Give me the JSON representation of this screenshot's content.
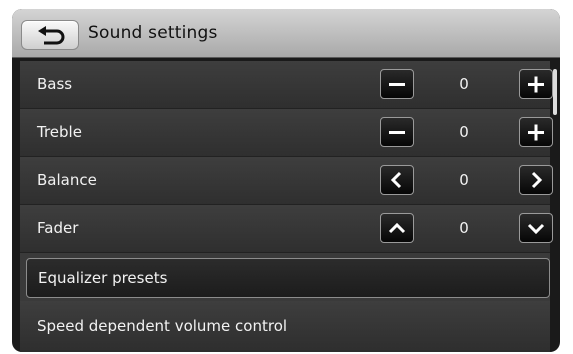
{
  "header": {
    "title": "Sound settings",
    "back_icon": "back-arrow-icon"
  },
  "rows": [
    {
      "label": "Bass",
      "value": "0",
      "left_icon": "minus-icon",
      "right_icon": "plus-icon"
    },
    {
      "label": "Treble",
      "value": "0",
      "left_icon": "minus-icon",
      "right_icon": "plus-icon"
    },
    {
      "label": "Balance",
      "value": "0",
      "left_icon": "chevron-left-icon",
      "right_icon": "chevron-right-icon"
    },
    {
      "label": "Fader",
      "value": "0",
      "left_icon": "chevron-up-icon",
      "right_icon": "chevron-down-icon"
    }
  ],
  "equalizer": {
    "label": "Equalizer presets"
  },
  "speed_volume": {
    "label": "Speed dependent volume control"
  },
  "colors": {
    "background": "#1a1a1a",
    "titlebar": "#bdbdbd",
    "text": "#f2f2f2",
    "border": "#9a9a9a"
  }
}
